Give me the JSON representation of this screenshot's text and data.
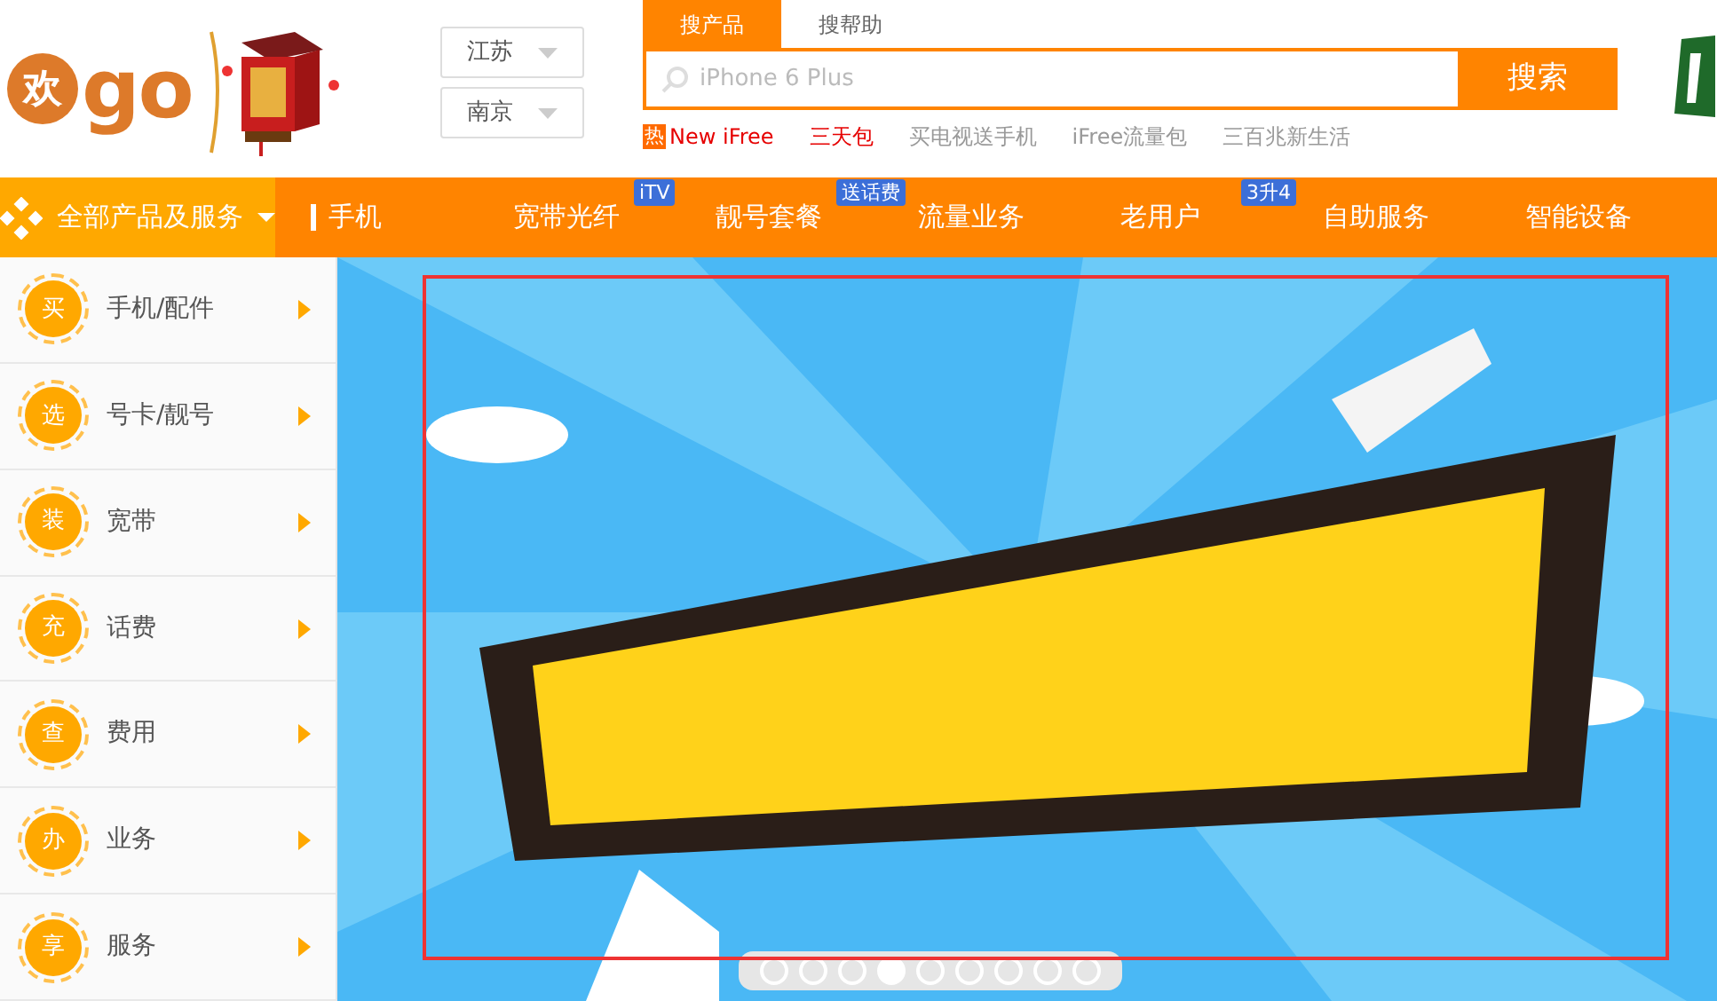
{
  "logo": {
    "mark": "欢",
    "text": "go"
  },
  "location": {
    "province": "江苏",
    "city": "南京"
  },
  "search": {
    "tabs": [
      {
        "label": "搜产品",
        "selected": true
      },
      {
        "label": "搜帮助",
        "selected": false
      }
    ],
    "placeholder": "iPhone 6 Plus",
    "button": "搜索",
    "hot_badge": "热",
    "hot_links": [
      {
        "label": "New iFree",
        "highlight": true
      },
      {
        "label": "三天包",
        "highlight": true
      },
      {
        "label": "买电视送手机",
        "highlight": false
      },
      {
        "label": "iFree流量包",
        "highlight": false
      },
      {
        "label": "三百兆新生活",
        "highlight": false
      }
    ]
  },
  "nav": {
    "all_menu": "全部产品及服务",
    "items": [
      {
        "label": "手机",
        "marker": true
      },
      {
        "label": "宽带光纤",
        "badge": "iTV",
        "marker": false
      },
      {
        "label": "靓号套餐",
        "badge": "送话费",
        "marker": false
      },
      {
        "label": "流量业务",
        "marker": false
      },
      {
        "label": "老用户",
        "badge": "3升4",
        "marker": false
      },
      {
        "label": "自助服务",
        "marker": false
      },
      {
        "label": "智能设备",
        "marker": false
      }
    ]
  },
  "sidebar": {
    "items": [
      {
        "icon": "买",
        "label": "手机/配件"
      },
      {
        "icon": "选",
        "label": "号卡/靓号"
      },
      {
        "icon": "装",
        "label": "宽带"
      },
      {
        "icon": "充",
        "label": "话费"
      },
      {
        "icon": "查",
        "label": "费用"
      },
      {
        "icon": "办",
        "label": "业务"
      },
      {
        "icon": "享",
        "label": "服务"
      }
    ]
  },
  "banner": {
    "kind": "picture",
    "dots": [
      {
        "selected": false
      },
      {
        "selected": false
      },
      {
        "selected": false
      },
      {
        "selected": true
      },
      {
        "selected": false
      },
      {
        "selected": false
      },
      {
        "selected": false
      },
      {
        "selected": false
      },
      {
        "selected": false
      }
    ]
  }
}
